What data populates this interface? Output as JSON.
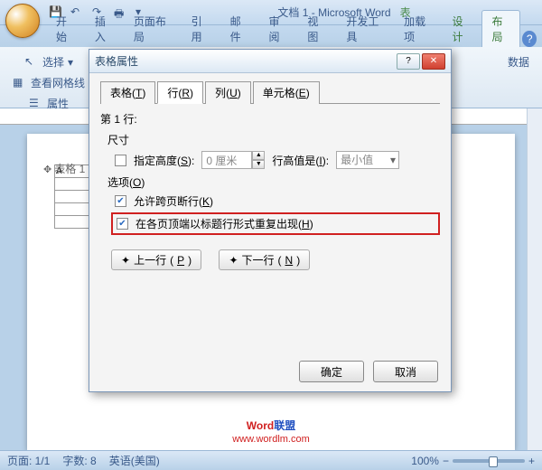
{
  "window": {
    "doc_title": "文档 1",
    "app": "Microsoft Word",
    "context": "表"
  },
  "ribbon": {
    "tabs": [
      "开始",
      "插入",
      "页面布局",
      "引用",
      "邮件",
      "审阅",
      "视图",
      "开发工具",
      "加载项"
    ],
    "ctx_tabs": [
      "设计",
      "布局"
    ],
    "active": "布局",
    "select": "选择",
    "gridlines": "查看网格线",
    "props": "属性",
    "data": "数据"
  },
  "dialog": {
    "title": "表格属性",
    "tabs": [
      {
        "l": "表格",
        "u": "T"
      },
      {
        "l": "行",
        "u": "R"
      },
      {
        "l": "列",
        "u": "U"
      },
      {
        "l": "单元格",
        "u": "E"
      }
    ],
    "row_label": "第 1 行:",
    "size_label": "尺寸",
    "spec_height": "指定高度",
    "spec_height_u": "S",
    "height_val": "0 厘米",
    "rhis": "行高值是",
    "rhis_u": "I",
    "rh_mode": "最小值",
    "options_label": "选项",
    "options_u": "O",
    "allow_break": "允许跨页断行",
    "allow_break_u": "K",
    "repeat_header": "在各页顶端以标题行形式重复出现",
    "repeat_header_u": "H",
    "prev": "上一行",
    "prev_u": "P",
    "next": "下一行",
    "next_u": "N",
    "ok": "确定",
    "cancel": "取消"
  },
  "doc": {
    "marker": "表格 1",
    "cell": "A"
  },
  "status": {
    "page": "页面: 1/1",
    "words": "字数: 8",
    "lang": "英语(美国)",
    "zoom": "100%"
  },
  "watermark": {
    "t1": "Word",
    "t2": "联盟",
    "url": "www.wordlm.com"
  }
}
